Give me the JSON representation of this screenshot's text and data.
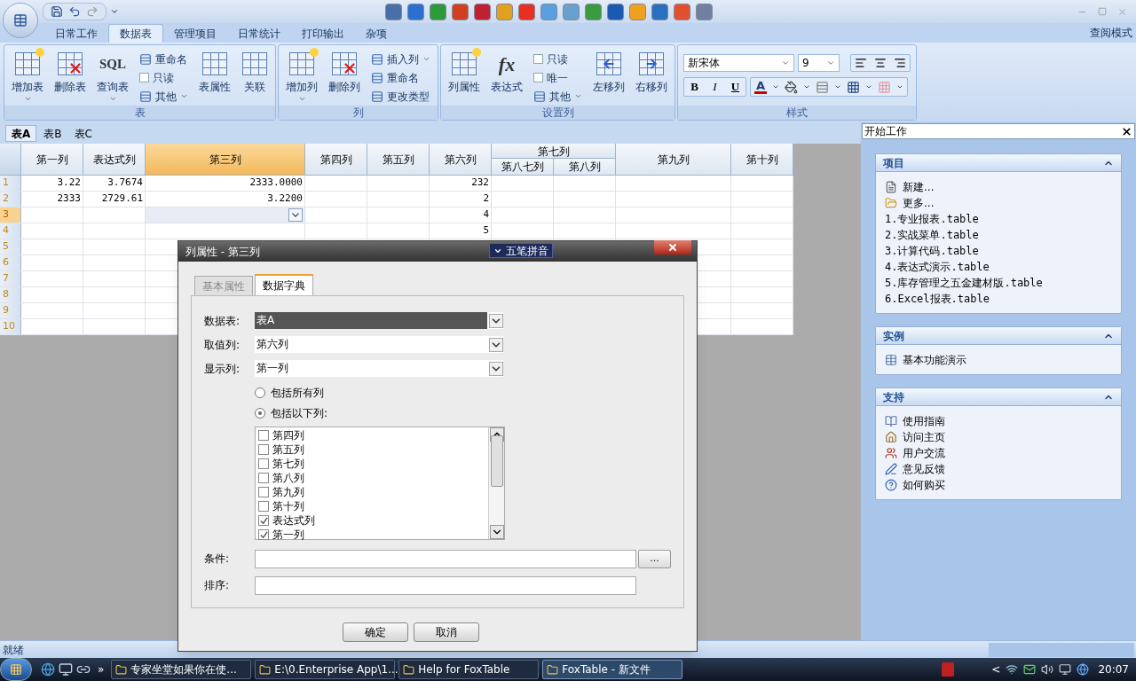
{
  "ribbon_tabs": [
    {
      "label": "日常工作",
      "selected": false
    },
    {
      "label": "数据表",
      "selected": true
    },
    {
      "label": "管理项目",
      "selected": false
    },
    {
      "label": "日常统计",
      "selected": false
    },
    {
      "label": "打印输出",
      "selected": false
    },
    {
      "label": "杂项",
      "selected": false
    }
  ],
  "mode_label": "查阅模式",
  "ribbon_groups": [
    {
      "title": "表",
      "items": [
        {
          "kind": "large",
          "label": "增加表",
          "dropdown": true
        },
        {
          "kind": "large",
          "label": "删除表",
          "dropdown": false
        },
        {
          "kind": "large",
          "label": "查询表",
          "dropdown": true,
          "icon_text": "SQL"
        },
        {
          "kind": "stack",
          "items": [
            {
              "kind": "small",
              "label": "重命名",
              "dropdown": false
            },
            {
              "kind": "check",
              "label": "只读",
              "checked": false
            },
            {
              "kind": "small",
              "label": "其他",
              "dropdown": true
            }
          ]
        },
        {
          "kind": "large",
          "label": "表属性",
          "dropdown": false
        },
        {
          "kind": "large",
          "label": "关联",
          "dropdown": false
        }
      ]
    },
    {
      "title": "列",
      "items": [
        {
          "kind": "large",
          "label": "增加列",
          "dropdown": true
        },
        {
          "kind": "large",
          "label": "删除列",
          "dropdown": false
        },
        {
          "kind": "stack",
          "items": [
            {
              "kind": "small",
              "label": "插入列",
              "dropdown": true
            },
            {
              "kind": "small",
              "label": "重命名",
              "dropdown": false
            },
            {
              "kind": "small",
              "label": "更改类型",
              "dropdown": false
            }
          ]
        }
      ]
    },
    {
      "title": "设置列",
      "items": [
        {
          "kind": "large",
          "label": "列属性",
          "dropdown": false
        },
        {
          "kind": "large",
          "label": "表达式",
          "dropdown": false,
          "icon_text": "fx"
        },
        {
          "kind": "stack",
          "items": [
            {
              "kind": "check",
              "label": "只读",
              "checked": false
            },
            {
              "kind": "check",
              "label": "唯一",
              "checked": false
            },
            {
              "kind": "small",
              "label": "其他",
              "dropdown": true
            }
          ]
        },
        {
          "kind": "large",
          "label": "左移列",
          "dropdown": false
        },
        {
          "kind": "large",
          "label": "右移列",
          "dropdown": false
        }
      ]
    },
    {
      "title": "样式",
      "kind": "style",
      "font": "新宋体",
      "size": "9",
      "format_buttons": [
        "B",
        "I",
        "U"
      ],
      "font_color_letter": "A"
    }
  ],
  "sheet_tabs": [
    {
      "label": "表A",
      "selected": true
    },
    {
      "label": "表B",
      "selected": false
    },
    {
      "label": "表C",
      "selected": false
    }
  ],
  "grid": {
    "columns": [
      {
        "label": "第一列",
        "selected": false
      },
      {
        "label": "表达式列",
        "selected": false
      },
      {
        "label": "第三列",
        "selected": true
      },
      {
        "label": "第四列",
        "selected": false
      },
      {
        "label": "第五列",
        "selected": false
      },
      {
        "label": "第六列",
        "selected": false
      },
      {
        "label": "第七列",
        "selected": false,
        "children": [
          {
            "label": "第八七列"
          },
          {
            "label": "第八列"
          }
        ]
      },
      {
        "label": "第九列",
        "selected": false
      },
      {
        "label": "第十列",
        "selected": false
      }
    ],
    "rows": [
      {
        "number": "1",
        "selected": false,
        "cells": [
          "3.22",
          "3.7674",
          "2333.0000",
          null,
          null,
          "232",
          null,
          null,
          null,
          null
        ]
      },
      {
        "number": "2",
        "selected": false,
        "cells": [
          "2333",
          "2729.61",
          "3.2200",
          null,
          null,
          "2",
          null,
          null,
          null,
          null
        ]
      },
      {
        "number": "3",
        "selected": true,
        "cells": [
          null,
          null,
          null,
          null,
          null,
          "4",
          null,
          null,
          null,
          null
        ]
      },
      {
        "number": "4",
        "selected": false,
        "cells": [
          null,
          null,
          null,
          null,
          null,
          "5",
          null,
          null,
          null,
          null
        ]
      },
      {
        "number": "5",
        "selected": false,
        "cells": [
          null,
          null,
          null,
          null,
          null,
          null,
          null,
          null,
          null,
          null
        ]
      },
      {
        "number": "6",
        "selected": false,
        "cells": [
          null,
          null,
          null,
          null,
          null,
          null,
          null,
          null,
          null,
          null
        ]
      },
      {
        "number": "7",
        "selected": false,
        "cells": [
          null,
          null,
          null,
          null,
          null,
          null,
          null,
          null,
          null,
          null
        ]
      },
      {
        "number": "8",
        "selected": false,
        "cells": [
          null,
          null,
          null,
          null,
          null,
          null,
          null,
          null,
          null,
          null
        ]
      },
      {
        "number": "9",
        "selected": false,
        "cells": [
          null,
          null,
          null,
          null,
          null,
          null,
          null,
          null,
          null,
          null
        ]
      },
      {
        "number": "10",
        "selected": false,
        "cells": [
          null,
          null,
          null,
          null,
          null,
          null,
          null,
          null,
          null,
          null
        ]
      }
    ]
  },
  "task_pane": {
    "title": "开始工作",
    "sections": [
      {
        "title": "项目",
        "expanded": true,
        "items": [
          {
            "kind": "new",
            "label": "新建..."
          },
          {
            "kind": "open",
            "label": "更多..."
          },
          {
            "kind": "recent",
            "label": "1.专业报表.table"
          },
          {
            "kind": "recent",
            "label": "2.实战菜单.table"
          },
          {
            "kind": "recent",
            "label": "3.计算代码.table"
          },
          {
            "kind": "recent",
            "label": "4.表达式演示.table"
          },
          {
            "kind": "recent",
            "label": "5.库存管理之五金建材版.table"
          },
          {
            "kind": "recent",
            "label": "6.Excel报表.table"
          }
        ]
      },
      {
        "title": "实例",
        "expanded": true,
        "items": [
          {
            "kind": "table",
            "label": "基本功能演示"
          }
        ]
      },
      {
        "title": "支持",
        "expanded": true,
        "items": [
          {
            "kind": "guide",
            "label": "使用指南"
          },
          {
            "kind": "home",
            "label": "访问主页"
          },
          {
            "kind": "users",
            "label": "用户交流"
          },
          {
            "kind": "feedback",
            "label": "意见反馈"
          },
          {
            "kind": "buy",
            "label": "如何购买"
          }
        ]
      }
    ]
  },
  "dialog": {
    "title": "列属性 - 第三列",
    "ime_label": "五笔拼音",
    "tabs": [
      {
        "label": "基本属性",
        "selected": false
      },
      {
        "label": "数据字典",
        "selected": true
      }
    ],
    "fields": [
      {
        "label": "数据表:",
        "value": "表A",
        "highlighted": true
      },
      {
        "label": "取值列:",
        "value": "第六列",
        "highlighted": false
      },
      {
        "label": "显示列:",
        "value": "第一列",
        "highlighted": false
      }
    ],
    "radios": [
      {
        "label": "包括所有列",
        "selected": false
      },
      {
        "label": "包括以下列:",
        "selected": true
      }
    ],
    "column_list": [
      {
        "label": "第四列",
        "checked": false
      },
      {
        "label": "第五列",
        "checked": false
      },
      {
        "label": "第七列",
        "checked": false
      },
      {
        "label": "第八列",
        "checked": false
      },
      {
        "label": "第九列",
        "checked": false
      },
      {
        "label": "第十列",
        "checked": false
      },
      {
        "label": "表达式列",
        "checked": true
      },
      {
        "label": "第一列",
        "checked": true
      }
    ],
    "condition": {
      "label": "条件:",
      "browse_button": "..."
    },
    "sort": {
      "label": "排序:"
    },
    "buttons": [
      "确定",
      "取消"
    ]
  },
  "status_bar": {
    "text": "就绪"
  },
  "taskbar": {
    "tasks": [
      {
        "label": "专家坐堂如果你在使...",
        "selected": false
      },
      {
        "label": "E:\\0.Enterprise App\\1...",
        "selected": false
      },
      {
        "label": "Help for FoxTable",
        "selected": false
      },
      {
        "label": "FoxTable - 新文件",
        "selected": true
      }
    ],
    "more": "»",
    "tray_arrow": "<",
    "clock": "20:07"
  }
}
